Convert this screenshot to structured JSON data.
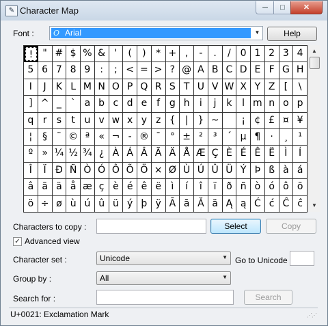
{
  "window": {
    "title": "Character Map",
    "app_icon": "character-map-icon",
    "minimize_glyph": "─",
    "maximize_glyph": "□",
    "close_glyph": "✕"
  },
  "font": {
    "label": "Font :",
    "value": "Arial",
    "font_type_glyph": "O"
  },
  "help_label": "Help",
  "grid_chars": [
    "!",
    "\"",
    "#",
    "$",
    "%",
    "&",
    "'",
    "(",
    ")",
    "*",
    "+",
    ",",
    "-",
    ".",
    "/",
    "0",
    "1",
    "2",
    "3",
    "4",
    "5",
    "6",
    "7",
    "8",
    "9",
    ":",
    ";",
    "<",
    "=",
    ">",
    "?",
    "@",
    "A",
    "B",
    "C",
    "D",
    "E",
    "F",
    "G",
    "H",
    "I",
    "J",
    "K",
    "L",
    "M",
    "N",
    "O",
    "P",
    "Q",
    "R",
    "S",
    "T",
    "U",
    "V",
    "W",
    "X",
    "Y",
    "Z",
    "[",
    "\\",
    "]",
    "^",
    "_",
    "`",
    "a",
    "b",
    "c",
    "d",
    "e",
    "f",
    "g",
    "h",
    "i",
    "j",
    "k",
    "l",
    "m",
    "n",
    "o",
    "p",
    "q",
    "r",
    "s",
    "t",
    "u",
    "v",
    "w",
    "x",
    "y",
    "z",
    "{",
    "|",
    "}",
    "~",
    " ",
    "¡",
    "¢",
    "£",
    "¤",
    "¥",
    "¦",
    "§",
    "¨",
    "©",
    "ª",
    "«",
    "¬",
    "-",
    "®",
    "¯",
    "°",
    "±",
    "²",
    "³",
    "´",
    "µ",
    "¶",
    "·",
    "¸",
    "¹",
    "º",
    "»",
    "¼",
    "½",
    "¾",
    "¿",
    "À",
    "Á",
    "Â",
    "Ã",
    "Ä",
    "Å",
    "Æ",
    "Ç",
    "È",
    "É",
    "Ê",
    "Ë",
    "Ì",
    "Í",
    "Î",
    "Ï",
    "Ð",
    "Ñ",
    "Ò",
    "Ó",
    "Ô",
    "Õ",
    "Ö",
    "×",
    "Ø",
    "Ù",
    "Ú",
    "Û",
    "Ü",
    "Ý",
    "Þ",
    "ß",
    "à",
    "á",
    "â",
    "ã",
    "ä",
    "å",
    "æ",
    "ç",
    "è",
    "é",
    "ê",
    "ë",
    "ì",
    "í",
    "î",
    "ï",
    "ð",
    "ñ",
    "ò",
    "ó",
    "ô",
    "õ",
    "ö",
    "÷",
    "ø",
    "ù",
    "ú",
    "û",
    "ü",
    "ý",
    "þ",
    "ÿ",
    "Ā",
    "ā",
    "Ă",
    "ă",
    "Ą",
    "ą",
    "Ć",
    "ć",
    "Ĉ",
    "ĉ"
  ],
  "selected_index": 0,
  "copy": {
    "label": "Characters to copy :",
    "value": "",
    "select_label": "Select",
    "copy_label": "Copy"
  },
  "advanced_view": {
    "label": "Advanced view",
    "checked_glyph": "✓"
  },
  "character_set": {
    "label": "Character set :",
    "value": "Unicode"
  },
  "go_to_unicode": {
    "label": "Go to Unicode :",
    "value": ""
  },
  "group_by": {
    "label": "Group by :",
    "value": "All"
  },
  "search": {
    "label": "Search for :",
    "value": "",
    "button_label": "Search"
  },
  "status": "U+0021: Exclamation Mark"
}
